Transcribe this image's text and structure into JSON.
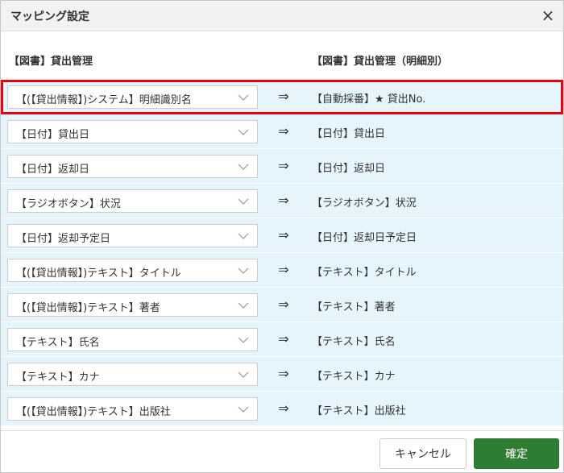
{
  "dialog": {
    "title": "マッピング設定",
    "close_glyph": "×"
  },
  "columns": {
    "left_header": "【図書】貸出管理",
    "right_header": "【図書】貸出管理（明細別）"
  },
  "mapping_arrow": "⇒",
  "rows": [
    {
      "source": "【(【貸出情報】)システム】明細識別名",
      "target": "【自動採番】★ 貸出No.",
      "selected": true
    },
    {
      "source": "【日付】貸出日",
      "target": "【日付】貸出日",
      "selected": false
    },
    {
      "source": "【日付】返却日",
      "target": "【日付】返却日",
      "selected": false
    },
    {
      "source": "【ラジオボタン】状況",
      "target": "【ラジオボタン】状況",
      "selected": false
    },
    {
      "source": "【日付】返却予定日",
      "target": "【日付】返却日予定日",
      "selected": false
    },
    {
      "source": "【(【貸出情報】)テキスト】タイトル",
      "target": "【テキスト】タイトル",
      "selected": false
    },
    {
      "source": "【(【貸出情報】)テキスト】著者",
      "target": "【テキスト】著者",
      "selected": false
    },
    {
      "source": "【テキスト】氏名",
      "target": "【テキスト】氏名",
      "selected": false
    },
    {
      "source": "【テキスト】カナ",
      "target": "【テキスト】カナ",
      "selected": false
    },
    {
      "source": "【(【貸出情報】)テキスト】出版社",
      "target": "【テキスト】出版社",
      "selected": false
    }
  ],
  "footer": {
    "cancel_label": "キャンセル",
    "ok_label": "確定"
  },
  "colors": {
    "row_background": "#e6f5fb",
    "highlight_border": "#e60012",
    "ok_button": "#2e7d32"
  },
  "icons": {
    "close": "close-icon",
    "dropdown": "chevron-down-icon",
    "mapping": "right-double-arrow-icon"
  }
}
